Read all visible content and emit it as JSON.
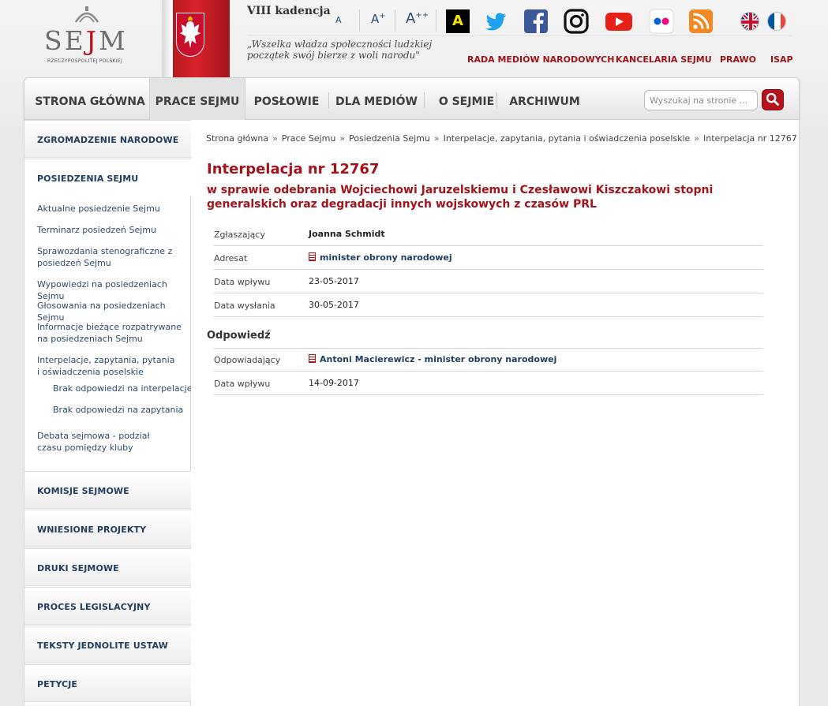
{
  "header": {
    "logo_word_a": "SE",
    "logo_word_b": "J",
    "logo_word_c": "M",
    "logo_sub": "RZECZYPOSPOLITEJ POLSKIEJ",
    "kadencja": "VIII kadencja",
    "quote_line1": "„Wszelka władza społeczności ludzkiej",
    "quote_line2": "początek swój bierze z woli narodu\"",
    "font_small": "A",
    "font_medium": "A",
    "font_medium_sup": "+",
    "font_large": "A",
    "font_large_sup": "++",
    "contrast": "A",
    "social_icons": [
      "twitter-icon",
      "facebook-icon",
      "instagram-icon",
      "youtube-icon",
      "flickr-icon",
      "rss-icon"
    ],
    "languages": [
      "english-flag-icon",
      "french-flag-icon"
    ],
    "links": [
      "RADA MEDIÓW NARODOWYCH",
      "KANCELARIA SEJMU",
      "PRAWO",
      "ISAP"
    ]
  },
  "nav": {
    "items": [
      "STRONA GŁÓWNA",
      "PRACE SEJMU",
      "POSŁOWIE",
      "DLA MEDIÓW",
      "O SEJMIE",
      "ARCHIWUM"
    ],
    "active": "PRACE SEJMU",
    "search_placeholder": "Wyszukaj na stronie ..."
  },
  "sidebar": {
    "heading_top": "ZGROMADZENIE NARODOWE",
    "heading_current": "POSIEDZENIA SEJMU",
    "links": [
      "Aktualne posiedzenie Sejmu",
      "Terminarz posiedzeń Sejmu",
      "Sprawozdania stenograficzne z posiedzeń Sejmu",
      "Wypowiedzi na posiedzeniach Sejmu",
      "Głosowania na posiedzeniach Sejmu",
      "Informacje bieżące rozpatrywane na posiedzeniach Sejmu",
      "Interpelacje, zapytania, pytania i oświadczenia poselskie",
      "Brak odpowiedzi na interpelacje",
      "Brak odpowiedzi na zapytania",
      "Debata sejmowa - podział czasu pomiędzy kluby"
    ],
    "sections": [
      "KOMISJE SEJMOWE",
      "WNIESIONE PROJEKTY",
      "DRUKI SEJMOWE",
      "PROCES LEGISLACYJNY",
      "TEKSTY JEDNOLITE USTAW",
      "PETYCJE"
    ]
  },
  "breadcrumb": [
    "Strona główna",
    "Prace Sejmu",
    "Posiedzenia Sejmu",
    "Interpelacje, zapytania, pytania i oświadczenia poselskie",
    "Interpelacja nr 12767"
  ],
  "breadcrumb_sep": "»",
  "content": {
    "title": "Interpelacja nr 12767",
    "subtitle": "w sprawie odebrania Wojciechowi Jaruzelskiemu i Czesławowi Kiszczakowi stopni generalskich oraz degradacji innych wojskowych z czasów PRL",
    "details": [
      {
        "label": "Zgłaszający",
        "value": "Joanna Schmidt"
      },
      {
        "label": "Adresat",
        "value": "minister obrony narodowej"
      },
      {
        "label": "Data wpływu",
        "value": "23-05-2017"
      },
      {
        "label": "Data wysłania",
        "value": "30-05-2017"
      }
    ],
    "answer_heading": "Odpowiedź",
    "answer": [
      {
        "label": "Odpowiadający",
        "value": "Antoni Macierewicz - minister obrony narodowej"
      },
      {
        "label": "Data wpływu",
        "value": "14-09-2017"
      }
    ]
  }
}
